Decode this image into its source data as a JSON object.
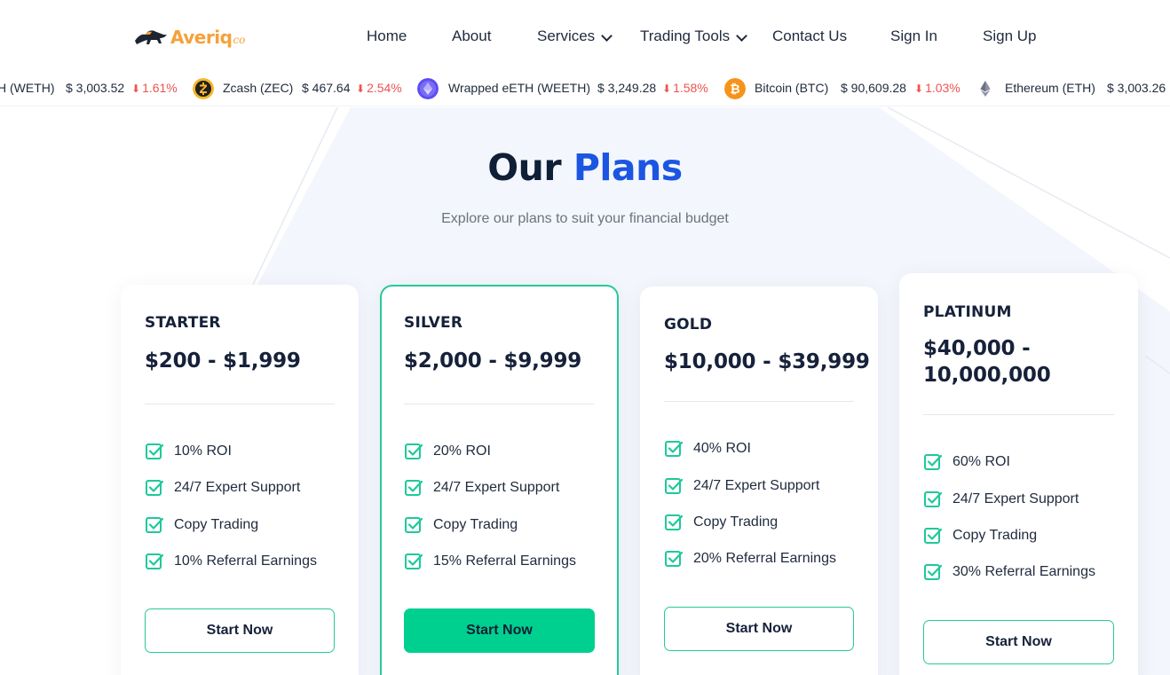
{
  "brand": {
    "logo_text": "Averiq",
    "logo_suffix": "co",
    "accent_color": "#f5a13a"
  },
  "nav": {
    "home": "Home",
    "about": "About",
    "services": "Services",
    "trading_tools": "Trading Tools",
    "contact": "Contact Us",
    "sign_in": "Sign In",
    "sign_up": "Sign Up"
  },
  "ticker": [
    {
      "name": "H (WETH)",
      "price": "$ 3,003.52",
      "change": "1.61%",
      "direction": "down",
      "icon": ""
    },
    {
      "name": "Zcash (ZEC)",
      "price": "$ 467.64",
      "change": "2.54%",
      "direction": "down",
      "icon": "zcash-icon"
    },
    {
      "name": "Wrapped eETH (WEETH)",
      "price": "$ 3,249.28",
      "change": "1.58%",
      "direction": "down",
      "icon": "weeth-icon"
    },
    {
      "name": "Bitcoin (BTC)",
      "price": "$ 90,609.28",
      "change": "1.03%",
      "direction": "down",
      "icon": "bitcoin-icon"
    },
    {
      "name": "Ethereum (ETH)",
      "price": "$ 3,003.26",
      "change": "",
      "direction": "",
      "icon": "ethereum-icon"
    }
  ],
  "section": {
    "title_main": "Our",
    "title_accent": "Plans",
    "subtitle": "Explore our plans to suit your financial budget"
  },
  "plans": [
    {
      "name": "STARTER",
      "price": "$200 - $1,999",
      "features": [
        "10% ROI",
        "24/7 Expert Support",
        "Copy Trading",
        "10% Referral Earnings"
      ],
      "button": "Start Now"
    },
    {
      "name": "SILVER",
      "price": "$2,000 - $9,999",
      "features": [
        "20% ROI",
        "24/7 Expert Support",
        "Copy Trading",
        "15% Referral Earnings"
      ],
      "button": "Start Now"
    },
    {
      "name": "GOLD",
      "price": "$10,000 - $39,999",
      "features": [
        "40% ROI",
        "24/7 Expert Support",
        "Copy Trading",
        "20% Referral Earnings"
      ],
      "button": "Start Now"
    },
    {
      "name": "PLATINUM",
      "price_line1": "$40,000 -",
      "price_line2": "10,000,000",
      "features": [
        "60% ROI",
        "24/7 Expert Support",
        "Copy Trading",
        "30% Referral Earnings"
      ],
      "button": "Start Now"
    }
  ],
  "colors": {
    "primary": "#1b55e2",
    "success": "#00d08f",
    "success_border": "#27c99a",
    "down": "#ef5350",
    "heading": "#0f1f35"
  }
}
